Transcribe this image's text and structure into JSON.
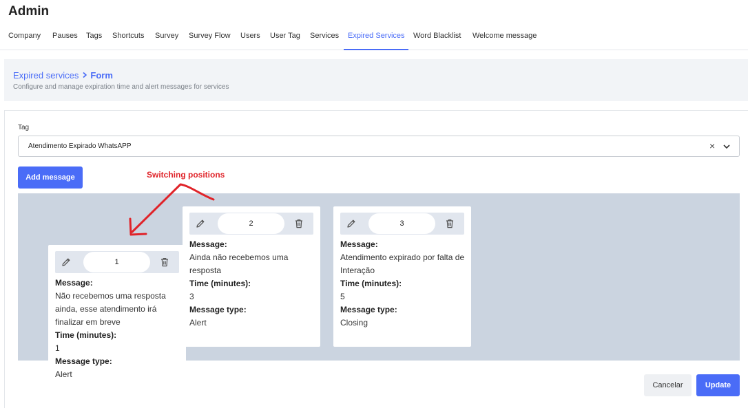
{
  "app": {
    "title": "Admin"
  },
  "tabs": [
    {
      "label": "Company",
      "active": false
    },
    {
      "label": "Pauses",
      "active": false
    },
    {
      "label": "Tags",
      "active": false
    },
    {
      "label": "Shortcuts",
      "active": false
    },
    {
      "label": "Survey",
      "active": false
    },
    {
      "label": "Survey Flow",
      "active": false
    },
    {
      "label": "Users",
      "active": false
    },
    {
      "label": "User Tag",
      "active": false
    },
    {
      "label": "Services",
      "active": false
    },
    {
      "label": "Expired Services",
      "active": true
    },
    {
      "label": "Word Blacklist",
      "active": false
    },
    {
      "label": "Welcome message",
      "active": false
    }
  ],
  "header": {
    "breadcrumb_parent": "Expired services",
    "breadcrumb_current": "Form",
    "subtitle": "Configure and manage expiration time and alert messages for services"
  },
  "form": {
    "tag_label": "Tag",
    "tag_value": "Atendimento Expirado WhatsAPP",
    "clear_symbol": "×",
    "add_message_label": "Add message"
  },
  "labels": {
    "message": "Message:",
    "time": "Time (minutes):",
    "type": "Message type:"
  },
  "messages": [
    {
      "order": "1",
      "message": "Não recebemos uma resposta ainda, esse atendimento irá finalizar em breve",
      "time": "1",
      "type": "Alert"
    },
    {
      "order": "2",
      "message": "Ainda não recebemos uma resposta",
      "time": "3",
      "type": "Alert"
    },
    {
      "order": "3",
      "message": "Atendimento expirado por falta de Interação",
      "time": "5",
      "type": "Closing"
    }
  ],
  "annotation": {
    "text": "Switching positions",
    "color": "#e0242a"
  },
  "actions": {
    "cancel_label": "Cancelar",
    "update_label": "Update"
  },
  "colors": {
    "accent": "#4a6cf7",
    "drop_area": "#cbd4e0",
    "header_bg": "#f2f4f7"
  },
  "icons": {
    "edit": "pencil-icon",
    "delete": "trash-icon",
    "dropdown": "chevron-down-icon",
    "clear": "clear-icon"
  }
}
